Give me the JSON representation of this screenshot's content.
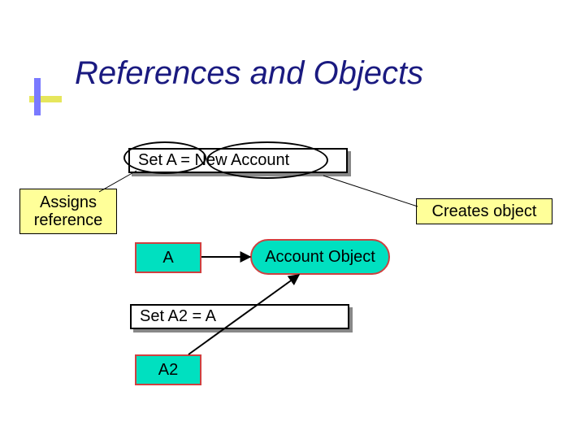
{
  "title": "References and Objects",
  "code1": "Set A = New Account",
  "code2": "Set A2 = A",
  "label_assigns_line1": "Assigns",
  "label_assigns_line2": "reference",
  "label_creates": "Creates object",
  "box_a": "A",
  "box_a2": "A2",
  "box_account_obj": "Account Object"
}
